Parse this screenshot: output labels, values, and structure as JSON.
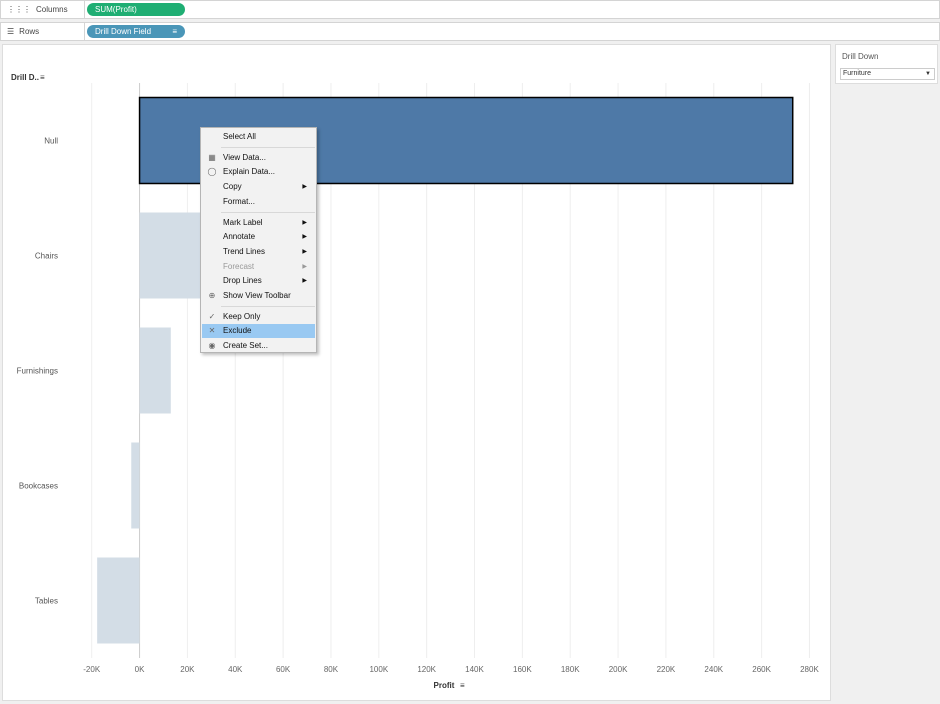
{
  "shelves": {
    "columns_label": "Columns",
    "columns_pill": "SUM(Profit)",
    "rows_label": "Rows",
    "rows_pill": "Drill Down Field"
  },
  "colors": {
    "columns_pill": "#1fae73",
    "rows_pill": "#4a96b8",
    "selected_bar": "#4e79a7",
    "faded_bar": "#d3dde6"
  },
  "filter": {
    "title": "Drill Down",
    "value": "Furniture"
  },
  "chart_data": {
    "type": "bar",
    "orientation": "horizontal",
    "row_header": "Drill D..",
    "xlabel": "Profit",
    "categories": [
      "Null",
      "Chairs",
      "Furnishings",
      "Bookcases",
      "Tables"
    ],
    "values": [
      273000,
      26590,
      13059,
      -3473,
      -17725
    ],
    "selected": [
      "Null"
    ],
    "xlim": [
      -32000,
      289000
    ],
    "xticks": [
      -20000,
      0,
      20000,
      40000,
      60000,
      80000,
      100000,
      120000,
      140000,
      160000,
      180000,
      200000,
      220000,
      240000,
      260000,
      280000
    ],
    "xtick_labels": [
      "-20K",
      "0K",
      "20K",
      "40K",
      "60K",
      "80K",
      "100K",
      "120K",
      "140K",
      "160K",
      "180K",
      "200K",
      "220K",
      "240K",
      "260K",
      "280K"
    ],
    "grid": true
  },
  "menu": {
    "items": [
      {
        "label": "Select All",
        "icon": ""
      },
      {
        "sep": true
      },
      {
        "label": "View Data...",
        "icon": "table-icon"
      },
      {
        "label": "Explain Data...",
        "icon": "lightbulb-icon"
      },
      {
        "label": "Copy",
        "icon": "",
        "submenu": true
      },
      {
        "label": "Format...",
        "icon": ""
      },
      {
        "sep": true
      },
      {
        "label": "Mark Label",
        "icon": "",
        "submenu": true
      },
      {
        "label": "Annotate",
        "icon": "",
        "submenu": true
      },
      {
        "label": "Trend Lines",
        "icon": "",
        "submenu": true
      },
      {
        "label": "Forecast",
        "icon": "",
        "submenu": true,
        "disabled": true
      },
      {
        "label": "Drop Lines",
        "icon": "",
        "submenu": true
      },
      {
        "label": "Show View Toolbar",
        "icon": "zoom-icon"
      },
      {
        "sep": true
      },
      {
        "label": "Keep Only",
        "icon": "check-icon"
      },
      {
        "label": "Exclude",
        "icon": "x-icon",
        "highlighted": true
      },
      {
        "label": "Create Set...",
        "icon": "set-icon"
      }
    ]
  }
}
